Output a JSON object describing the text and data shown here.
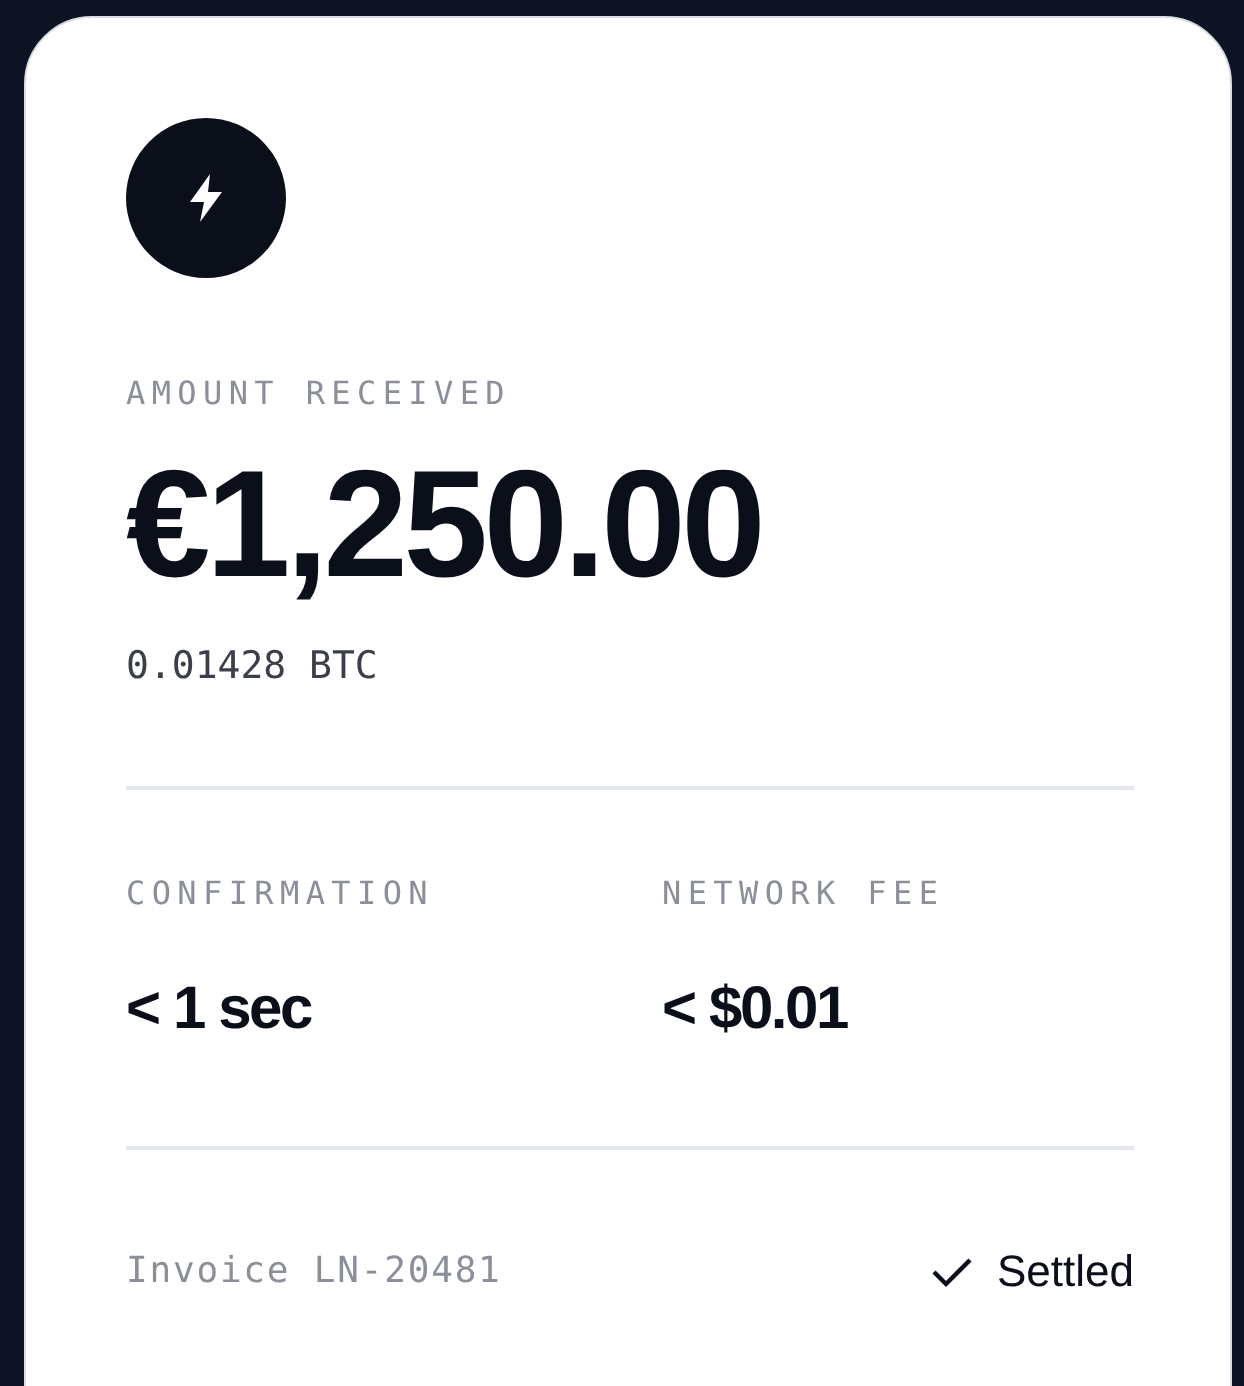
{
  "payment": {
    "label": "AMOUNT RECEIVED",
    "amount": "€1,250.00",
    "crypto_amount": "0.01428 BTC"
  },
  "stats": [
    {
      "label": "CONFIRMATION",
      "value": "< 1 sec"
    },
    {
      "label": "NETWORK FEE",
      "value": "< $0.01"
    }
  ],
  "footer": {
    "invoice": "Invoice LN-20481",
    "status": "Settled"
  }
}
